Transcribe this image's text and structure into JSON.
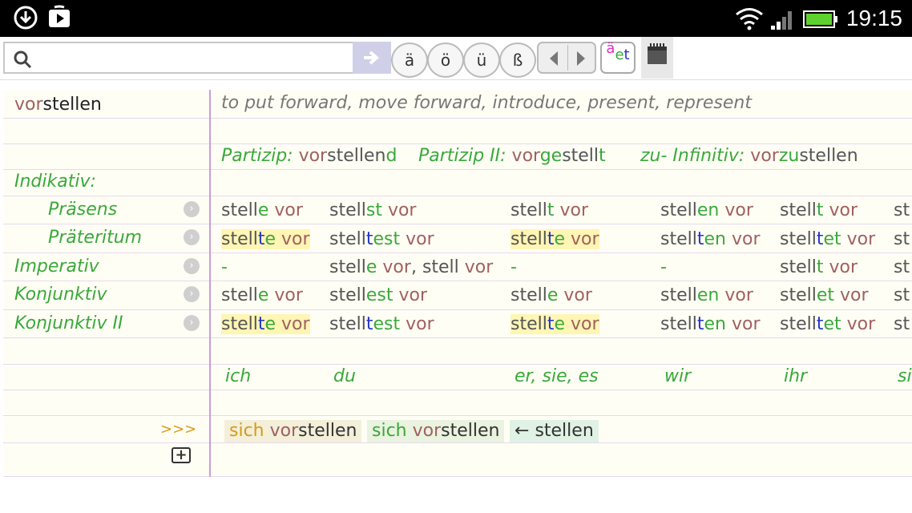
{
  "status": {
    "time": "19:15"
  },
  "toolbar": {
    "search_value": "",
    "umlaut_a": "ä",
    "umlaut_o": "ö",
    "umlaut_u": "ü",
    "eszett": "ß",
    "color_btn_a": "ä",
    "color_btn_e": "e",
    "color_btn_t": "t"
  },
  "entry": {
    "headword_prefix": "vor",
    "headword_stem": "stellen",
    "translation": "to put forward, move forward, introduce, present, represent"
  },
  "participles": {
    "p1_label": "Partizip:",
    "p1_prefix": "vor",
    "p1_stem": "stellen",
    "p1_end": "d",
    "p2_label": "Partizip II:",
    "p2_prefix": "vor",
    "p2_ge": "ge",
    "p2_stem": "stell",
    "p2_end": "t",
    "zu_label": "zu- Infinitiv:",
    "zu_prefix": "vor",
    "zu_zu": "zu",
    "zu_stem": "stellen"
  },
  "labels": {
    "indikativ": "Indikativ:",
    "praesens": "Präsens",
    "praeteritum": "Präteritum",
    "imperativ": "Imperativ",
    "konjunktiv": "Konjunktiv",
    "konjunktiv2": "Konjunktiv II",
    "more": ">>>",
    "plus": "+"
  },
  "forms": {
    "stem": "stell",
    "stelle": "stelle",
    "vor": " vor",
    "stell_short": "stell",
    "sep": ", ",
    "dash": "-",
    "ending_e": "e",
    "ending_st": "st",
    "ending_t": "t",
    "ending_en": "en",
    "ending_est": "est",
    "ending_et": "et",
    "trunc": "st"
  },
  "pronouns": [
    "ich",
    "du",
    "er, sie, es",
    "wir",
    "ihr",
    "si"
  ],
  "related": [
    {
      "prefix1": "sich ",
      "prefix2": "vor",
      "stem": "stellen"
    },
    {
      "prefix1": "sich ",
      "prefix2": "vor",
      "stem": "stellen"
    },
    {
      "arrow": "← ",
      "stem": "stellen"
    }
  ],
  "colors": {
    "green": "#3aa83a",
    "mauve": "#a06060",
    "blue": "#2233cc",
    "highlight": "#fff5b4",
    "orange": "#d89a1a"
  }
}
